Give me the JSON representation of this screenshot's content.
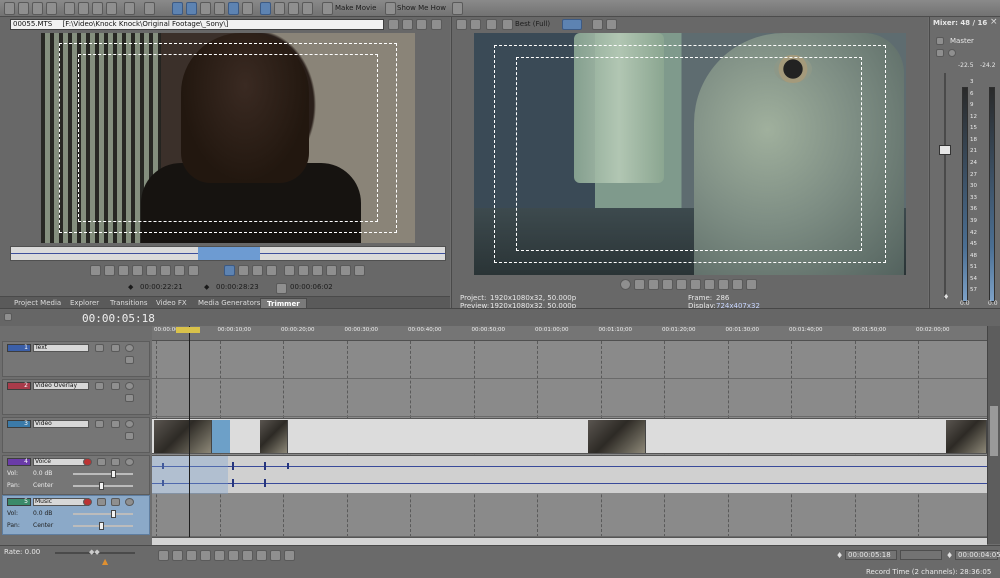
{
  "toolbar": {
    "make_movie": "Make Movie",
    "show_me_how": "Show Me How"
  },
  "trimmer": {
    "filename": "00055.MTS",
    "path": "[F:\\Video\\Knock Knock\\Original Footage\\_Sony\\]",
    "timecode_in": "00:00:22:21",
    "timecode_out": "00:00:28:23",
    "timecode_length": "00:00:06:02"
  },
  "tabs": [
    {
      "label": "Project Media"
    },
    {
      "label": "Explorer"
    },
    {
      "label": "Transitions"
    },
    {
      "label": "Video FX"
    },
    {
      "label": "Media Generators"
    },
    {
      "label": "Trimmer"
    }
  ],
  "preview": {
    "quality": "Best (Full)",
    "project_label": "Project:",
    "project_value": "1920x1080x32, 50.000p",
    "preview_label": "Preview:",
    "preview_value": "1920x1080x32, 50.000p",
    "frame_label": "Frame:",
    "frame_value": "286",
    "display_label": "Display:",
    "display_value": "724x407x32"
  },
  "mixer": {
    "title": "Mixer: 48 / 16",
    "master": "Master",
    "peak_left": "-22.5",
    "peak_right": "-24.2",
    "scale": [
      "3",
      "6",
      "9",
      "12",
      "15",
      "18",
      "21",
      "24",
      "27",
      "30",
      "33",
      "36",
      "39",
      "42",
      "45",
      "48",
      "51",
      "54",
      "57"
    ],
    "bottom_left": "0.0",
    "bottom_right": "0.0"
  },
  "timeline": {
    "current_time": "00:00:05:18",
    "ruler": [
      "00:00:00;00",
      "00:00:10;00",
      "00:00:20;00",
      "00:00:30;00",
      "00:00:40;00",
      "00:00:50;00",
      "00:01:00;00",
      "00:01:10;00",
      "00:01:20;00",
      "00:01:30;00",
      "00:01:40;00",
      "00:01:50;00",
      "00:02:00;00"
    ],
    "tracks": [
      {
        "num": "1",
        "name": "Text",
        "color": "#3b5fa8"
      },
      {
        "num": "2",
        "name": "Video Overlay",
        "color": "#a83b4a"
      },
      {
        "num": "3",
        "name": "Video",
        "color": "#3b7aa8"
      },
      {
        "num": "4",
        "name": "Voice",
        "color": "#6a3ba8",
        "vol": "0.0 dB",
        "pan": "Center"
      },
      {
        "num": "5",
        "name": "Music",
        "color": "#3b8a6a",
        "vol": "0.0 dB",
        "pan": "Center"
      }
    ],
    "vol_label": "Vol:",
    "pan_label": "Pan:"
  },
  "transport": {
    "rate": "Rate: 0.00",
    "position": "00:00:05:18",
    "record_time": "Record Time (2 channels): 28:36:05",
    "end_time": "00:00:04:05"
  }
}
